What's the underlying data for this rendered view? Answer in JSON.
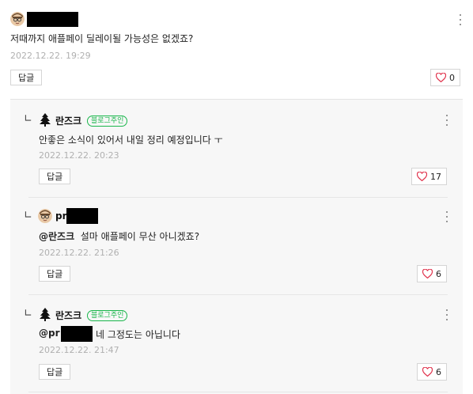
{
  "top_comment": {
    "text": "저때까지 애플페이 딜레이될 가능성은 없겠죠?",
    "date": "2022.12.22. 19:29",
    "reply_label": "답글",
    "like_count": "0"
  },
  "replies": [
    {
      "author": "란즈크",
      "badge": "블로그주인",
      "text": "안좋은 소식이 있어서 내일 정리 예정입니다 ㅜ",
      "date": "2022.12.22. 20:23",
      "reply_label": "답글",
      "like_count": "17"
    },
    {
      "author": "pr",
      "mention": "@란즈크",
      "text": "설마 애플페이 무산 아니겠죠?",
      "date": "2022.12.22. 21:26",
      "reply_label": "답글",
      "like_count": "6"
    },
    {
      "author": "란즈크",
      "badge": "블로그주인",
      "mention": "@pr",
      "text": "네 그정도는 아닙니다",
      "date": "2022.12.22. 21:47",
      "reply_label": "답글",
      "like_count": "6"
    }
  ],
  "colors": {
    "badge_green": "#19b64b",
    "heart_red": "#e0314b",
    "date_gray": "#b0b0b0"
  },
  "icons": [
    "avatar-icon",
    "tree-icon",
    "heart-icon",
    "more-icon",
    "reply-indent-icon"
  ]
}
